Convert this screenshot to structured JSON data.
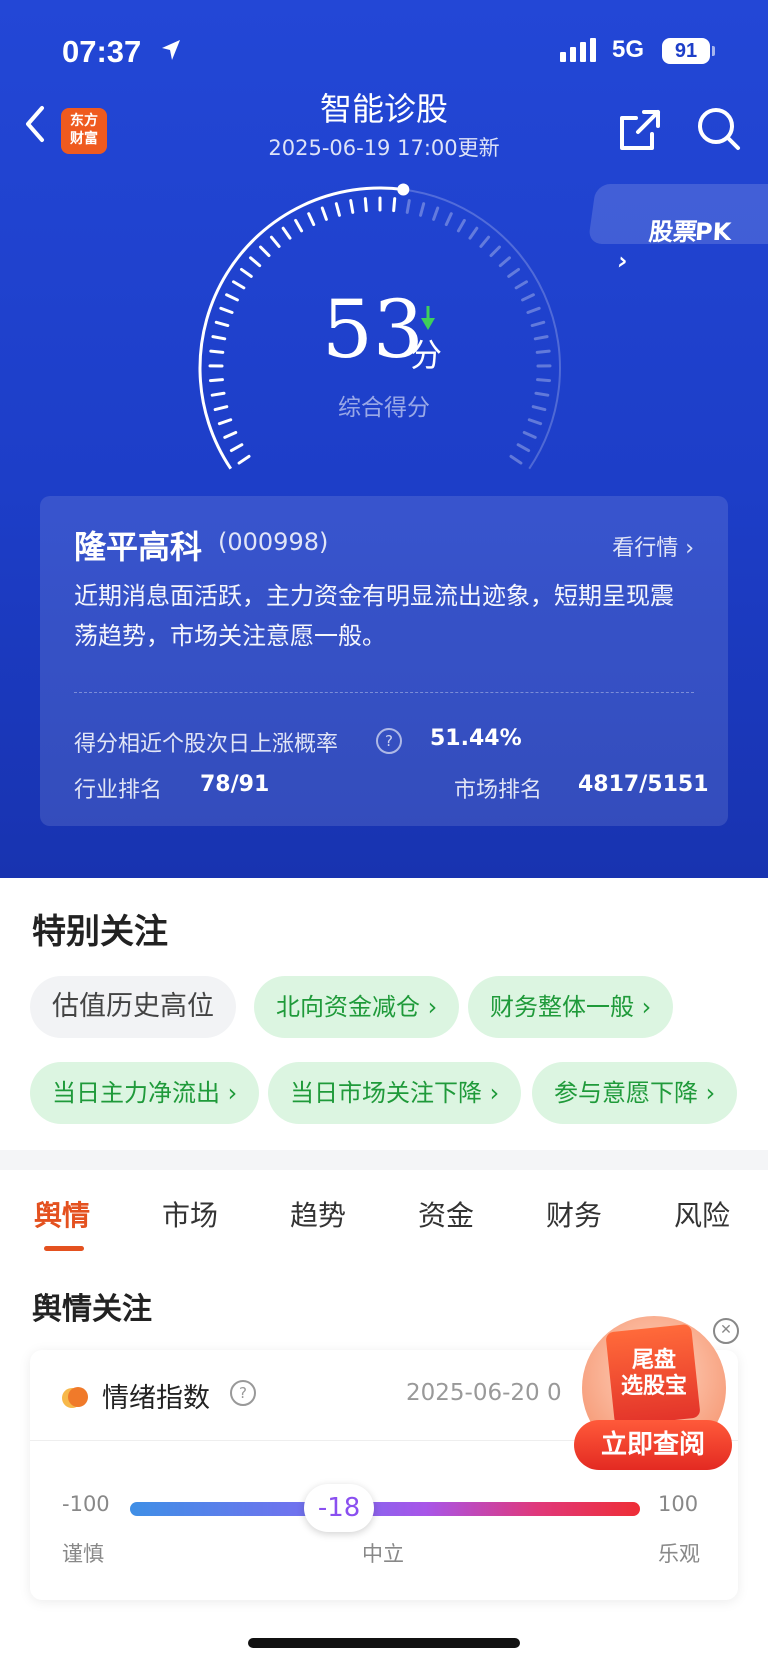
{
  "status": {
    "time": "07:37",
    "network": "5G",
    "battery": "91"
  },
  "nav": {
    "title": "智能诊股",
    "subtitle": "2025-06-19 17:00更新",
    "logo_line1": "东方",
    "logo_line2": "财富",
    "pk_label": "股票PK"
  },
  "score": {
    "value": "53",
    "unit": "分",
    "label": "综合得分",
    "max": 100,
    "trend": "down"
  },
  "stock": {
    "name": "隆平高科",
    "code": "(000998)",
    "link": "看行情",
    "summary": "近期消息面活跃，主力资金有明显流出迹象，短期呈现震荡趋势，市场关注意愿一般。",
    "prob_label": "得分相近个股次日上涨概率",
    "prob_value": "51.44%",
    "industry_label": "行业排名",
    "industry_value": "78/91",
    "market_label": "市场排名",
    "market_value": "4817/5151"
  },
  "special": {
    "title": "特别关注",
    "tags": [
      {
        "label": "估值历史高位",
        "style": "gray"
      },
      {
        "label": "北向资金减仓",
        "style": "green"
      },
      {
        "label": "财务整体一般",
        "style": "green"
      },
      {
        "label": "当日主力净流出",
        "style": "green"
      },
      {
        "label": "当日市场关注下降",
        "style": "green"
      },
      {
        "label": "参与意愿下降",
        "style": "green"
      }
    ]
  },
  "tabs": [
    "舆情",
    "市场",
    "趋势",
    "资金",
    "财务",
    "风险"
  ],
  "active_tab": "舆情",
  "sentiment": {
    "section_title": "舆情关注",
    "title": "情绪指数",
    "date": "2025-06-20 0",
    "min": "-100",
    "max": "100",
    "value": "-18",
    "value_num": -18,
    "label_left": "谨慎",
    "label_mid": "中立",
    "label_right": "乐观"
  },
  "promo": {
    "line1": "尾盘",
    "line2": "选股宝",
    "button": "立即查阅"
  },
  "colors": {
    "primary_blue": "#1d3ec8",
    "accent_orange": "#e4511f",
    "tag_green": "#1f9a3a"
  }
}
